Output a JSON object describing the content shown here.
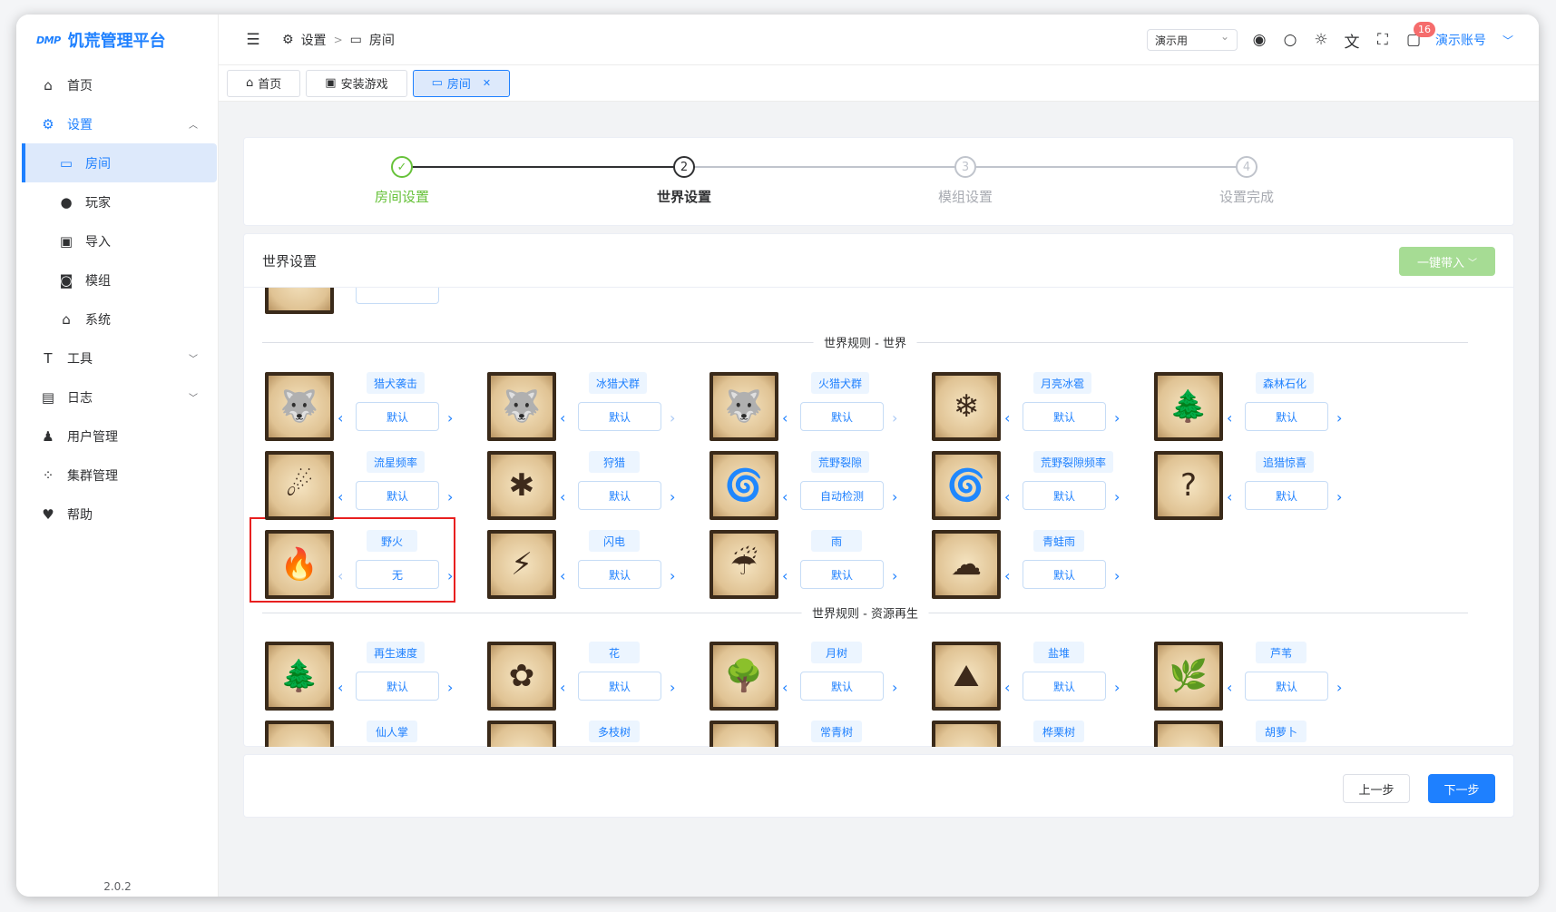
{
  "app": {
    "logo_mark": "DMP",
    "title": "饥荒管理平台",
    "version": "2.0.2"
  },
  "sidebar": {
    "items": [
      {
        "label": "首页",
        "icon": "home-icon"
      },
      {
        "label": "设置",
        "icon": "gear-icon"
      },
      {
        "label": "房间",
        "icon": "gamepad-icon"
      },
      {
        "label": "玩家",
        "icon": "user-icon"
      },
      {
        "label": "导入",
        "icon": "save-icon"
      },
      {
        "label": "模组",
        "icon": "mod-icon"
      },
      {
        "label": "系统",
        "icon": "house-icon"
      },
      {
        "label": "工具",
        "icon": "hammer-icon"
      },
      {
        "label": "日志",
        "icon": "log-icon"
      },
      {
        "label": "用户管理",
        "icon": "user-manage-icon"
      },
      {
        "label": "集群管理",
        "icon": "cluster-icon"
      },
      {
        "label": "帮助",
        "icon": "help-icon"
      }
    ]
  },
  "header": {
    "breadcrumb": [
      "设置",
      "房间"
    ],
    "select_value": "演示用",
    "notification_count": "16",
    "account": "演示账号"
  },
  "tabs": [
    {
      "label": "首页"
    },
    {
      "label": "安装游戏"
    },
    {
      "label": "房间"
    }
  ],
  "steps": [
    {
      "num": "✓",
      "label": "房间设置"
    },
    {
      "num": "2",
      "label": "世界设置"
    },
    {
      "num": "3",
      "label": "模组设置"
    },
    {
      "num": "4",
      "label": "设置完成"
    }
  ],
  "world": {
    "title": "世界设置",
    "apply_button": "一键带入",
    "section_world": "世界规则 - 世界",
    "section_regen": "世界规则 - 资源再生",
    "world_items": [
      {
        "name": "猎犬袭击",
        "value": "默认",
        "icon": "hound-icon"
      },
      {
        "name": "冰猎犬群",
        "value": "默认",
        "icon": "ice-hound-icon"
      },
      {
        "name": "火猎犬群",
        "value": "默认",
        "icon": "fire-hound-icon"
      },
      {
        "name": "月亮冰雹",
        "value": "默认",
        "icon": "moon-hail-icon"
      },
      {
        "name": "森林石化",
        "value": "默认",
        "icon": "petrify-icon"
      },
      {
        "name": "流星频率",
        "value": "默认",
        "icon": "meteor-icon"
      },
      {
        "name": "狩猎",
        "value": "默认",
        "icon": "hunt-icon"
      },
      {
        "name": "荒野裂隙",
        "value": "自动检测",
        "icon": "rift-icon"
      },
      {
        "name": "荒野裂隙频率",
        "value": "默认",
        "icon": "rift-freq-icon"
      },
      {
        "name": "追猎惊喜",
        "value": "默认",
        "icon": "hunt-surprise-icon"
      },
      {
        "name": "野火",
        "value": "无",
        "icon": "wildfire-icon"
      },
      {
        "name": "闪电",
        "value": "默认",
        "icon": "lightning-icon"
      },
      {
        "name": "雨",
        "value": "默认",
        "icon": "rain-icon"
      },
      {
        "name": "青蛙雨",
        "value": "默认",
        "icon": "frog-rain-icon"
      }
    ],
    "regen_items": [
      {
        "name": "再生速度",
        "value": "默认",
        "icon": "regen-tree-icon"
      },
      {
        "name": "花",
        "value": "默认",
        "icon": "flower-icon"
      },
      {
        "name": "月树",
        "value": "默认",
        "icon": "moon-tree-icon"
      },
      {
        "name": "盐堆",
        "value": "默认",
        "icon": "salt-icon"
      },
      {
        "name": "芦苇",
        "value": "默认",
        "icon": "reeds-icon"
      }
    ],
    "partial_items": [
      "仙人掌",
      "多枝树",
      "常青树",
      "桦栗树",
      "胡萝卜"
    ]
  },
  "footer": {
    "prev": "上一步",
    "next": "下一步"
  }
}
